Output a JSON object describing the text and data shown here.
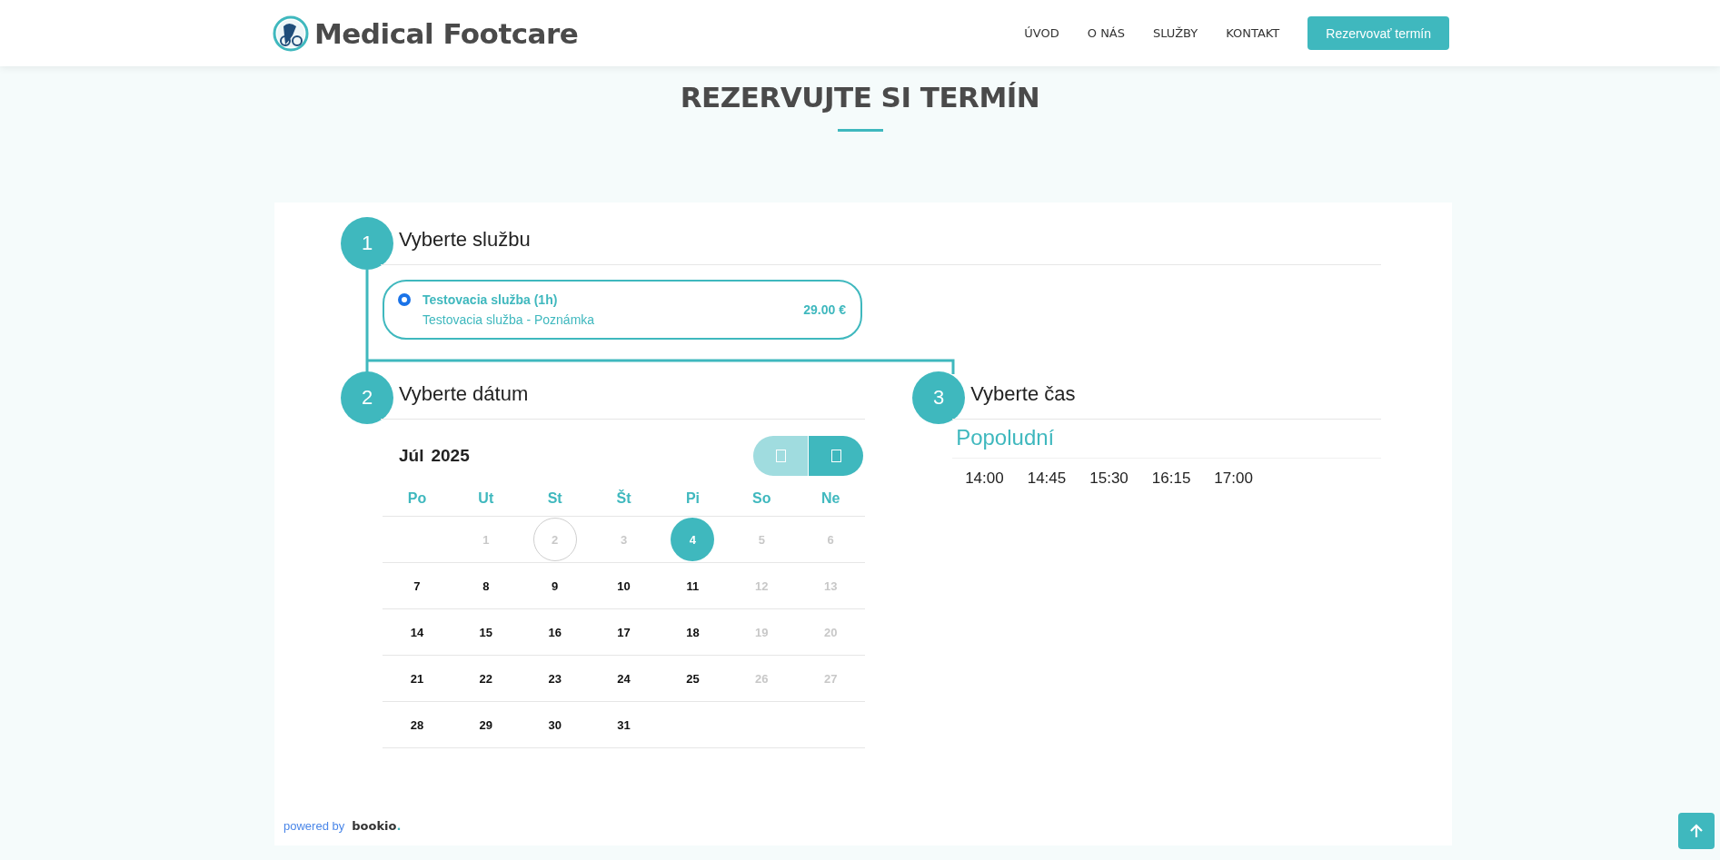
{
  "header": {
    "logo_text": "Medical Footcare",
    "nav": [
      {
        "label": "ÚVOD"
      },
      {
        "label": "O NÁS"
      },
      {
        "label": "SLUŽBY"
      },
      {
        "label": "KONTAKT"
      }
    ],
    "cta": "Rezervovať termín"
  },
  "page_title": "REZERVUJTE SI TERMÍN",
  "steps": [
    {
      "number": "1",
      "title": "Vyberte službu"
    },
    {
      "number": "2",
      "title": "Vyberte dátum"
    },
    {
      "number": "3",
      "title": "Vyberte čas"
    }
  ],
  "services": [
    {
      "name": "Testovacia služba (1h)",
      "note": "Testovacia služba - Poznámka",
      "price": "29.00 €",
      "selected": true
    }
  ],
  "calendar": {
    "month": "Júl",
    "year": "2025",
    "prev_disabled": true,
    "weekdays": [
      "Po",
      "Ut",
      "St",
      "Št",
      "Pi",
      "So",
      "Ne"
    ],
    "weeks": [
      [
        {
          "day": "1",
          "available": false,
          "today": false,
          "selected": false
        },
        {
          "day": "2",
          "available": false,
          "today": true,
          "selected": false
        },
        {
          "day": "3",
          "available": false,
          "today": false,
          "selected": false
        },
        {
          "day": "4",
          "available": true,
          "today": false,
          "selected": true
        },
        {
          "day": "5",
          "available": false,
          "today": false,
          "selected": false
        },
        {
          "day": "6",
          "available": false,
          "today": false,
          "selected": false
        }
      ],
      [
        {
          "day": "7",
          "available": true,
          "today": false,
          "selected": false
        },
        {
          "day": "8",
          "available": true,
          "today": false,
          "selected": false
        },
        {
          "day": "9",
          "available": true,
          "today": false,
          "selected": false
        },
        {
          "day": "10",
          "available": true,
          "today": false,
          "selected": false
        },
        {
          "day": "11",
          "available": true,
          "today": false,
          "selected": false
        },
        {
          "day": "12",
          "available": false,
          "today": false,
          "selected": false
        },
        {
          "day": "13",
          "available": false,
          "today": false,
          "selected": false
        }
      ],
      [
        {
          "day": "14",
          "available": true,
          "today": false,
          "selected": false
        },
        {
          "day": "15",
          "available": true,
          "today": false,
          "selected": false
        },
        {
          "day": "16",
          "available": true,
          "today": false,
          "selected": false
        },
        {
          "day": "17",
          "available": true,
          "today": false,
          "selected": false
        },
        {
          "day": "18",
          "available": true,
          "today": false,
          "selected": false
        },
        {
          "day": "19",
          "available": false,
          "today": false,
          "selected": false
        },
        {
          "day": "20",
          "available": false,
          "today": false,
          "selected": false
        }
      ],
      [
        {
          "day": "21",
          "available": true,
          "today": false,
          "selected": false
        },
        {
          "day": "22",
          "available": true,
          "today": false,
          "selected": false
        },
        {
          "day": "23",
          "available": true,
          "today": false,
          "selected": false
        },
        {
          "day": "24",
          "available": true,
          "today": false,
          "selected": false
        },
        {
          "day": "25",
          "available": true,
          "today": false,
          "selected": false
        },
        {
          "day": "26",
          "available": false,
          "today": false,
          "selected": false
        },
        {
          "day": "27",
          "available": false,
          "today": false,
          "selected": false
        }
      ],
      [
        {
          "day": "28",
          "available": true,
          "today": false,
          "selected": false
        },
        {
          "day": "29",
          "available": true,
          "today": false,
          "selected": false
        },
        {
          "day": "30",
          "available": true,
          "today": false,
          "selected": false
        },
        {
          "day": "31",
          "available": true,
          "today": false,
          "selected": false
        }
      ]
    ]
  },
  "times": {
    "section": "Popoludní",
    "slots": [
      {
        "time": "14:00",
        "selected": false
      },
      {
        "time": "14:45",
        "selected": false
      },
      {
        "time": "15:30",
        "selected": false
      },
      {
        "time": "16:15",
        "selected": false
      },
      {
        "time": "17:00",
        "selected": false
      }
    ]
  },
  "footer": {
    "powered_by": "powered by",
    "brand": "bookio",
    "brand_dot": "."
  }
}
